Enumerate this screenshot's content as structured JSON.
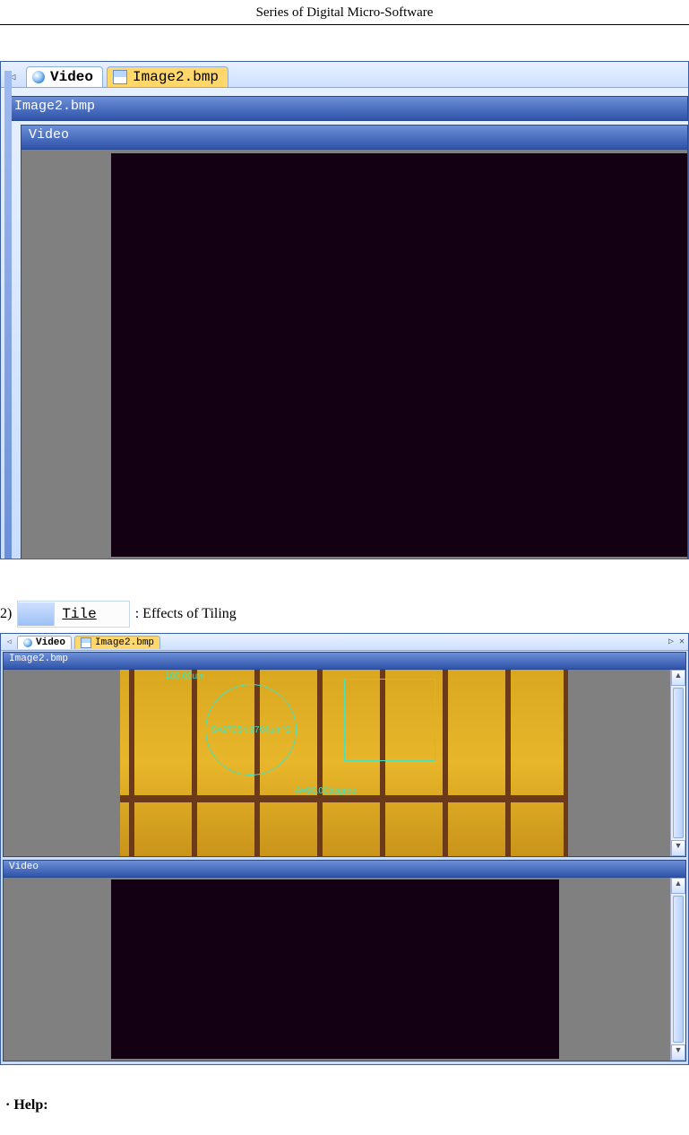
{
  "header": {
    "title": "Series of Digital Micro-Software"
  },
  "shot1": {
    "tabs": {
      "video": "Video",
      "image": "Image2.bmp"
    },
    "child1_title": "Image2.bmp",
    "child2_title": "Video"
  },
  "item2": {
    "number": "2)",
    "button_label": "Tile",
    "caption": ": Effects of Tiling"
  },
  "shot2": {
    "tabs": {
      "video": "Video",
      "image": "Image2.bmp"
    },
    "pane_top_title": "Image2.bmp",
    "pane_bot_title": "Video",
    "measurements": {
      "top_label": "100.00um",
      "circle_label": "S=27054.9704um^2",
      "angle_label": "A=90.00degree"
    }
  },
  "help": {
    "bullet": "·",
    "label": "Help:"
  }
}
